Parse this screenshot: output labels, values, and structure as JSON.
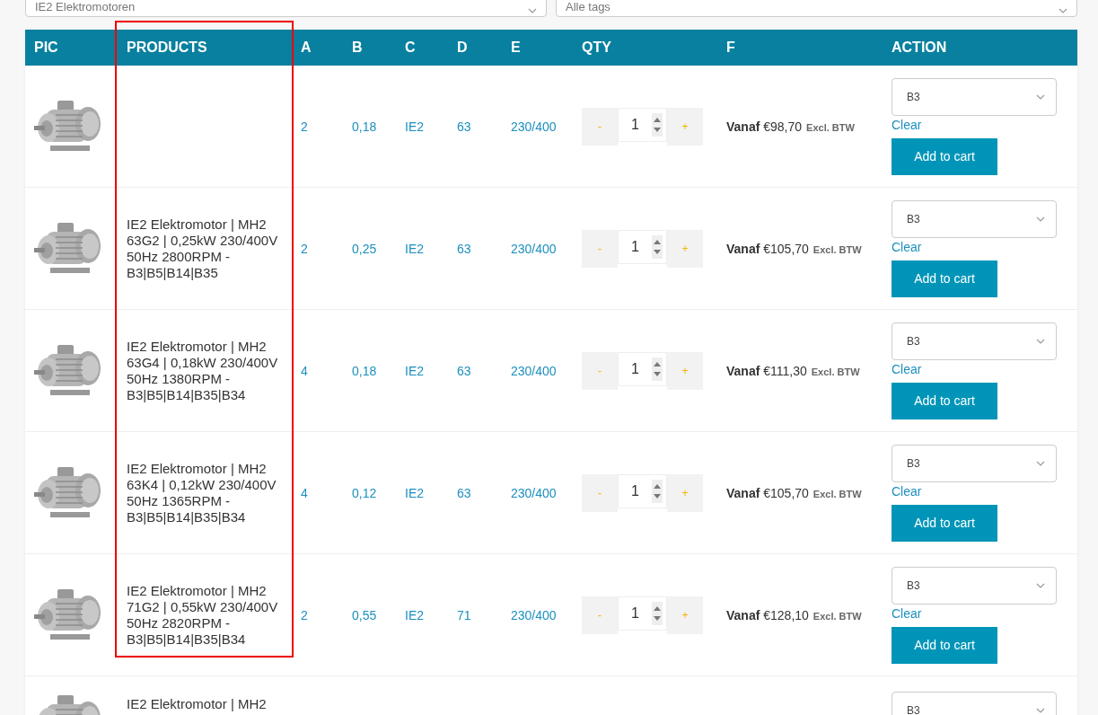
{
  "filters": [
    {
      "value": "IE2 Elektromotoren"
    },
    {
      "value": "Alle tags"
    }
  ],
  "annotation": {
    "kind": "frame"
  },
  "table": {
    "columns": [
      {
        "label": "PIC"
      },
      {
        "label": "PRODUCTS"
      },
      {
        "label": "A"
      },
      {
        "label": "B"
      },
      {
        "label": "C"
      },
      {
        "label": "D"
      },
      {
        "label": "E"
      },
      {
        "label": "QTY"
      },
      {
        "label": "F"
      },
      {
        "label": "ACTION"
      }
    ],
    "rows": [
      {
        "product": "",
        "a": "2",
        "b": "0,18",
        "c": "IE2",
        "d": "63",
        "e": "230/400",
        "qty_minus": "-",
        "qty": "1",
        "qty_plus": "+",
        "price": "**Vanaf** €98,70",
        "price_note": "Excl. BTW",
        "variant": "B3",
        "clear": "Clear",
        "button": "Add to cart"
      },
      {
        "product": "IE2 Elektromotor | MH2 63G2 | 0,25kW 230/400V 50Hz 2800RPM - B3|B5|B14|B35",
        "a": "2",
        "b": "0,25",
        "c": "IE2",
        "d": "63",
        "e": "230/400",
        "qty_minus": "-",
        "qty": "1",
        "qty_plus": "+",
        "price": "**Vanaf** €105,70",
        "price_note": "Excl. BTW",
        "variant": "B3",
        "clear": "Clear",
        "button": "Add to cart"
      },
      {
        "product": "IE2 Elektromotor | MH2 63G4 | 0,18kW 230/400V 50Hz 1380RPM - B3|B5|B14|B35|B34",
        "a": "4",
        "b": "0,18",
        "c": "IE2",
        "d": "63",
        "e": "230/400",
        "qty_minus": "-",
        "qty": "1",
        "qty_plus": "+",
        "price": "**Vanaf** €111,30",
        "price_note": "Excl. BTW",
        "variant": "B3",
        "clear": "Clear",
        "button": "Add to cart"
      },
      {
        "product": "IE2 Elektromotor | MH2 63K4 | 0,12kW 230/400V 50Hz 1365RPM - B3|B5|B14|B35|B34",
        "a": "4",
        "b": "0,12",
        "c": "IE2",
        "d": "63",
        "e": "230/400",
        "qty_minus": "-",
        "qty": "1",
        "qty_plus": "+",
        "price": "**Vanaf** €105,70",
        "price_note": "Excl. BTW",
        "variant": "B3",
        "clear": "Clear",
        "button": "Add to cart"
      },
      {
        "product": "IE2 Elektromotor | MH2 71G2 | 0,55kW 230/400V 50Hz 2820RPM - B3|B5|B14|B35|B34",
        "a": "2",
        "b": "0,55",
        "c": "IE2",
        "d": "71",
        "e": "230/400",
        "qty_minus": "-",
        "qty": "1",
        "qty_plus": "+",
        "price": "**Vanaf** €128,10",
        "price_note": "Excl. BTW",
        "variant": "B3",
        "clear": "Clear",
        "button": "Add to cart"
      },
      {
        "product": "IE2 Elektromotor | MH2",
        "variant": "B3"
      }
    ]
  }
}
